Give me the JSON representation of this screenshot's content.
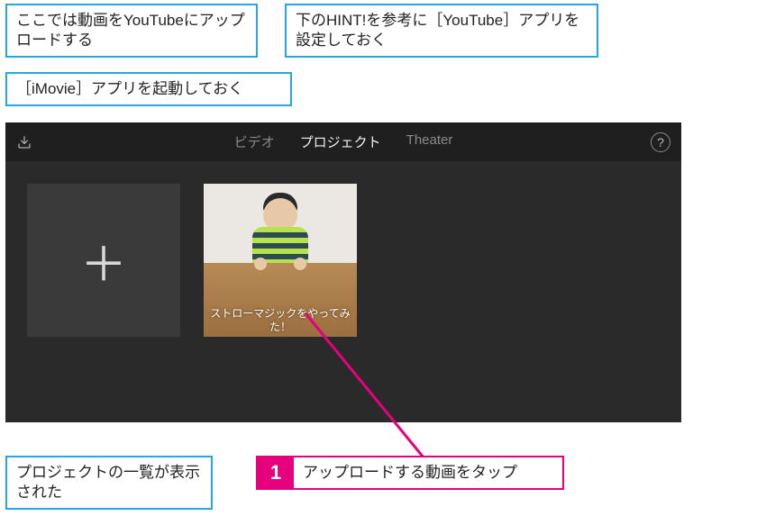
{
  "callouts": {
    "c1": "ここでは動画をYouTubeにアップロードする",
    "c2": "下のHINT!を参考に［YouTube］アプリを設定しておく",
    "c3": "［iMovie］アプリを起動しておく",
    "c4": "プロジェクトの一覧が表示された"
  },
  "step": {
    "num": "1",
    "text": "アップロードする動画をタップ"
  },
  "imovie": {
    "nav": {
      "video": "ビデオ",
      "project": "プロジェクト",
      "theater": "Theater"
    },
    "help_glyph": "?",
    "new_tile_glyph": "＋",
    "project_title": "ストローマジックをやってみた！"
  }
}
